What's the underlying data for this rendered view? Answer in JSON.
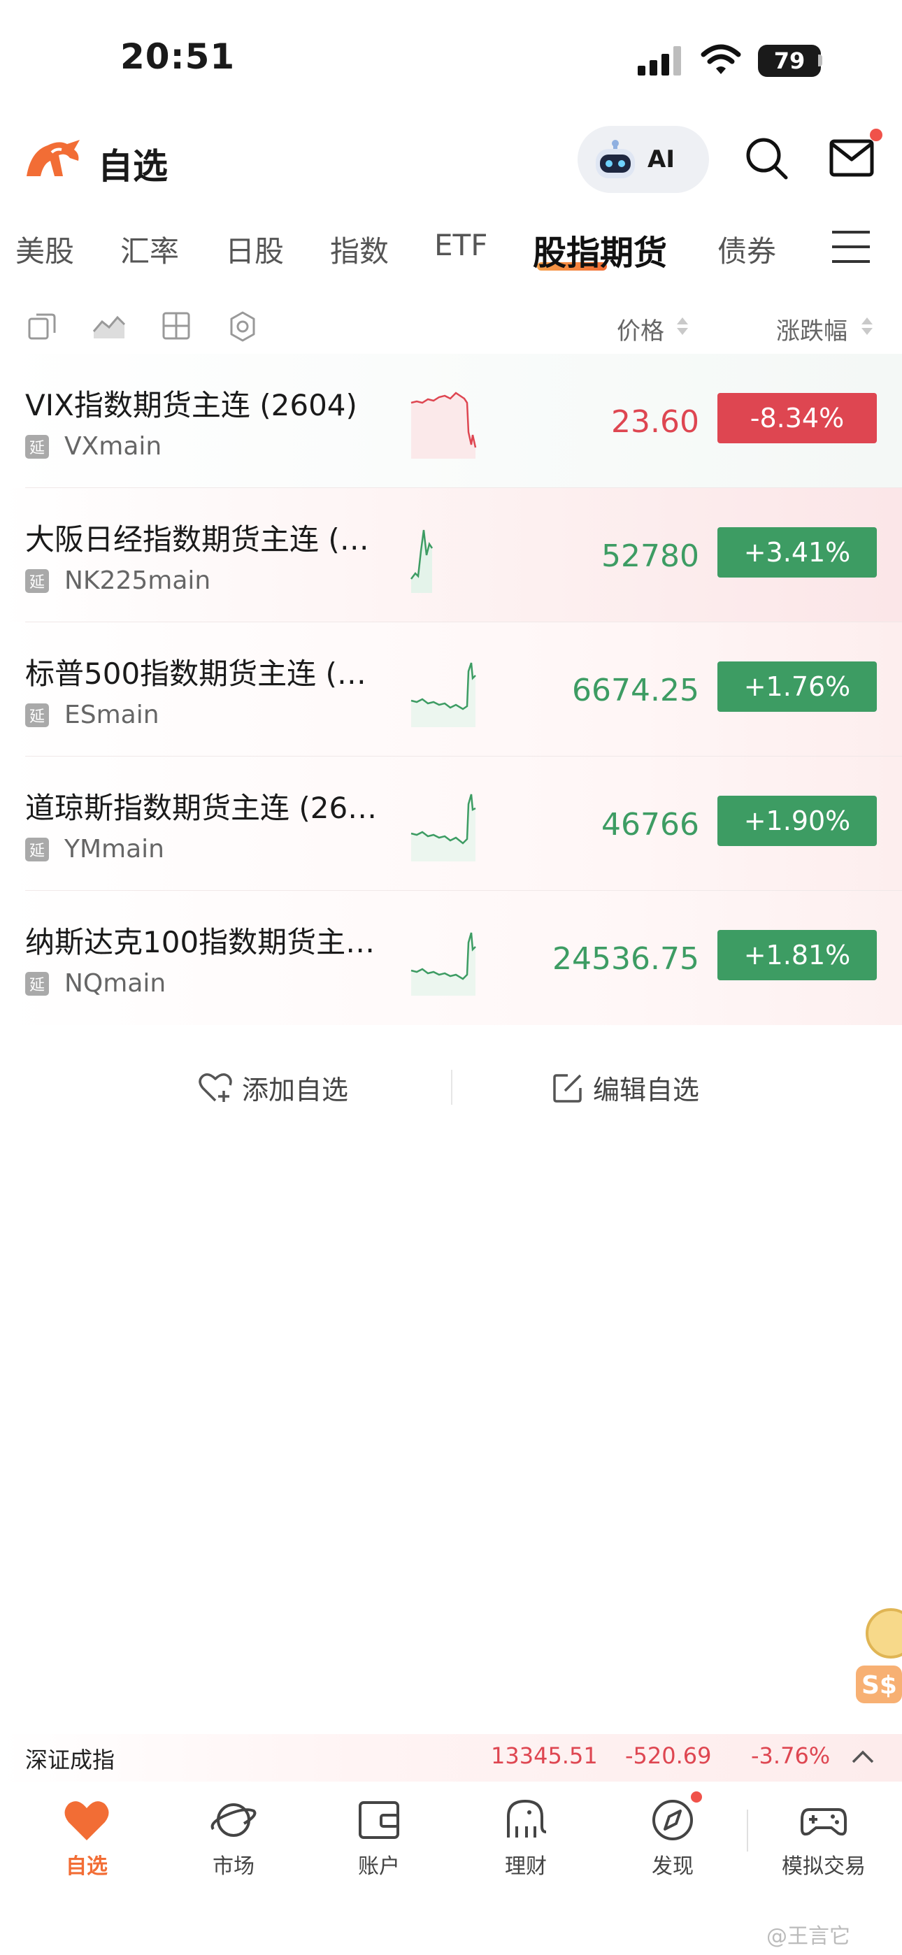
{
  "status_bar": {
    "time": "20:51",
    "battery": "79"
  },
  "header": {
    "title": "自选",
    "ai_label": "AI"
  },
  "tabs": [
    {
      "label": "美股"
    },
    {
      "label": "汇率"
    },
    {
      "label": "日股"
    },
    {
      "label": "指数"
    },
    {
      "label": "ETF"
    },
    {
      "label": "股指期货",
      "active": true
    },
    {
      "label": "债券"
    }
  ],
  "columns": {
    "price": "价格",
    "change": "涨跌幅"
  },
  "rows": [
    {
      "name": "VIX指数期货主连 (2604)",
      "badge": "延",
      "code": "VXmain",
      "price": "23.60",
      "change": "-8.34%",
      "direction": "down"
    },
    {
      "name": "大阪日经指数期货主连 (…",
      "badge": "延",
      "code": "NK225main",
      "price": "52780",
      "change": "+3.41%",
      "direction": "up"
    },
    {
      "name": "标普500指数期货主连 (…",
      "badge": "延",
      "code": "ESmain",
      "price": "6674.25",
      "change": "+1.76%",
      "direction": "up"
    },
    {
      "name": "道琼斯指数期货主连 (26…",
      "badge": "延",
      "code": "YMmain",
      "price": "46766",
      "change": "+1.90%",
      "direction": "up"
    },
    {
      "name": "纳斯达克100指数期货主…",
      "badge": "延",
      "code": "NQmain",
      "price": "24536.75",
      "change": "+1.81%",
      "direction": "up"
    }
  ],
  "actions": {
    "add": "添加自选",
    "edit": "编辑自选"
  },
  "ticker": {
    "name": "深证成指",
    "value": "13345.51",
    "change": "-520.69",
    "percent": "-3.76%"
  },
  "bottom_nav": [
    {
      "label": "自选",
      "icon": "heart-icon",
      "active": true
    },
    {
      "label": "市场",
      "icon": "planet-icon"
    },
    {
      "label": "账户",
      "icon": "wallet-icon"
    },
    {
      "label": "理财",
      "icon": "elephant-icon"
    },
    {
      "label": "发现",
      "icon": "compass-icon"
    },
    {
      "label": "模拟交易",
      "icon": "gamepad-icon"
    }
  ],
  "watermark": "@王言它",
  "colors": {
    "accent": "#f26d35",
    "up": "#3d9c63",
    "down": "#de4651"
  }
}
